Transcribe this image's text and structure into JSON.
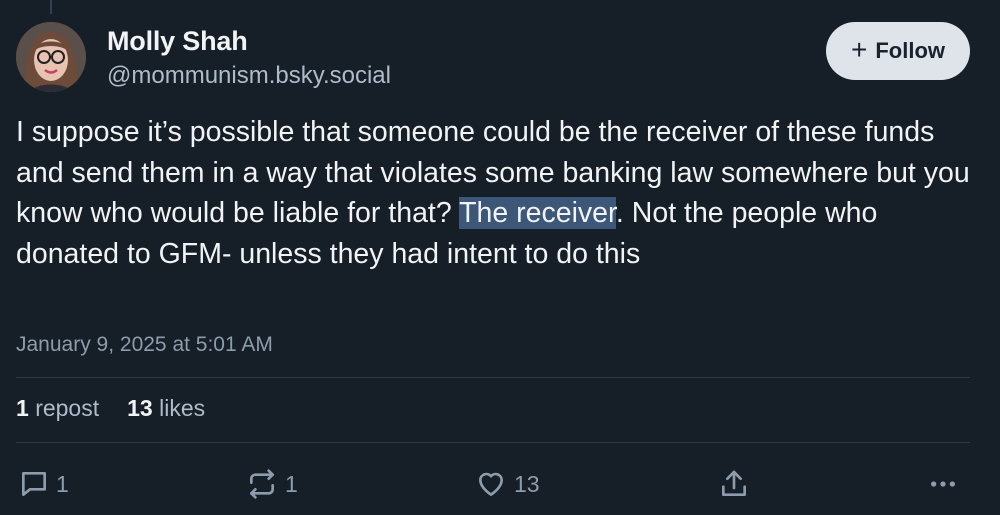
{
  "author": {
    "name": "Molly Shah",
    "handle": "@mommunism.bsky.social"
  },
  "follow_button": {
    "label": "Follow"
  },
  "post": {
    "text_before_highlight": "I suppose it’s possible that someone could be the receiver of these funds and send them in a way that violates some banking law somewhere but you know who would be liable for that? ",
    "highlighted_text": "The receiver",
    "text_after_highlight": ". Not the people who donated to GFM- unless they had intent to do this",
    "timestamp": "January 9, 2025 at 5:01 AM"
  },
  "stats": {
    "reposts_count": "1",
    "reposts_label": "repost",
    "likes_count": "13",
    "likes_label": "likes"
  },
  "actions": {
    "reply_count": "1",
    "repost_count": "1",
    "like_count": "13"
  },
  "colors": {
    "background": "#161e27",
    "highlight": "#3c5777",
    "muted_text": "#8d9cac",
    "follow_button_bg": "#dfe4ea"
  },
  "icons": [
    "reply-icon",
    "repost-icon",
    "heart-icon",
    "share-icon",
    "more-icon",
    "plus-icon"
  ]
}
